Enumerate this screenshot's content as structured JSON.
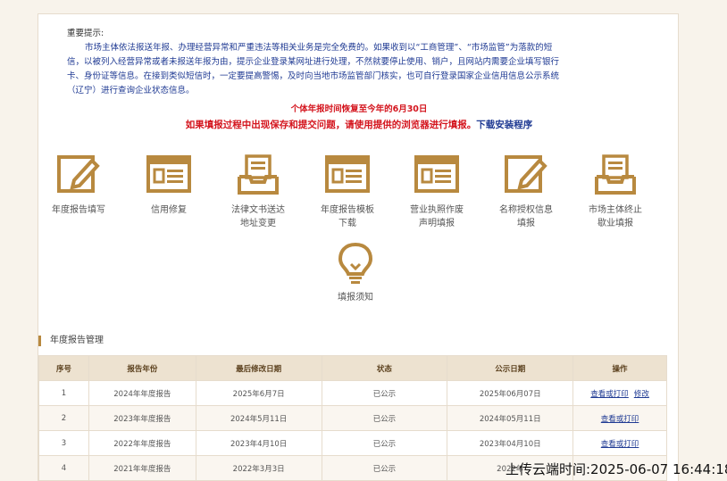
{
  "notice": {
    "heading": "重要提示:",
    "lines": [
      "市场主体依法报送年报、办理经营异常和严重违法等相关业务是完全免费的。如果收到以“工商管理”、“市场监管”为落款的短",
      "信，以被列入经营异常或者未报送年报为由，提示企业登录某网址进行处理，不然就要停止使用、销户，且网站内需要企业填写银行",
      "卡、身份证等信息。在接到类似短信时，一定要提高警惕，及时向当地市场监管部门核实，也可自行登录国家企业信用信息公示系统",
      "（辽宁）进行查询企业状态信息。"
    ],
    "red_line1": "个体年报时间恢复至今年的6月30日",
    "red_line2": "如果填报过程中出现保存和提交问题，请使用提供的浏览器进行填报。",
    "download_link": "下载安装程序"
  },
  "tiles": [
    {
      "label": "年度报告填写",
      "icon": "edit-icon"
    },
    {
      "label": "信用修复",
      "icon": "form-icon"
    },
    {
      "label": "法律文书送达\n地址变更",
      "icon": "inbox-icon"
    },
    {
      "label": "年度报告模板\n下载",
      "icon": "form-icon"
    },
    {
      "label": "营业执照作废\n声明填报",
      "icon": "form-icon"
    },
    {
      "label": "名称授权信息\n填报",
      "icon": "edit-icon"
    },
    {
      "label": "市场主体终止\n歇业填报",
      "icon": "inbox-icon"
    },
    {
      "label": "填报须知",
      "icon": "lightbulb-icon"
    }
  ],
  "section_title": "年度报告管理",
  "table": {
    "headers": [
      "序号",
      "报告年份",
      "最后修改日期",
      "状态",
      "公示日期",
      "操作"
    ],
    "rows": [
      {
        "no": "1",
        "year": "2024年年度报告",
        "modified": "2025年6月7日",
        "status": "已公示",
        "published": "2025年06月07日",
        "actions": [
          "查看或打印",
          "修改"
        ]
      },
      {
        "no": "2",
        "year": "2023年年度报告",
        "modified": "2024年5月11日",
        "status": "已公示",
        "published": "2024年05月11日",
        "actions": [
          "查看或打印"
        ]
      },
      {
        "no": "3",
        "year": "2022年年度报告",
        "modified": "2023年4月10日",
        "status": "已公示",
        "published": "2023年04月10日",
        "actions": [
          "查看或打印"
        ]
      },
      {
        "no": "4",
        "year": "2021年年度报告",
        "modified": "2022年3月3日",
        "status": "已公示",
        "published": "2022年",
        "actions": []
      }
    ]
  },
  "upload_stamp": "上传云端时间:2025-06-07 16:44:18",
  "colors": {
    "accent": "#b8893f",
    "notice": "#1f3a93",
    "alert": "#d4141d"
  }
}
